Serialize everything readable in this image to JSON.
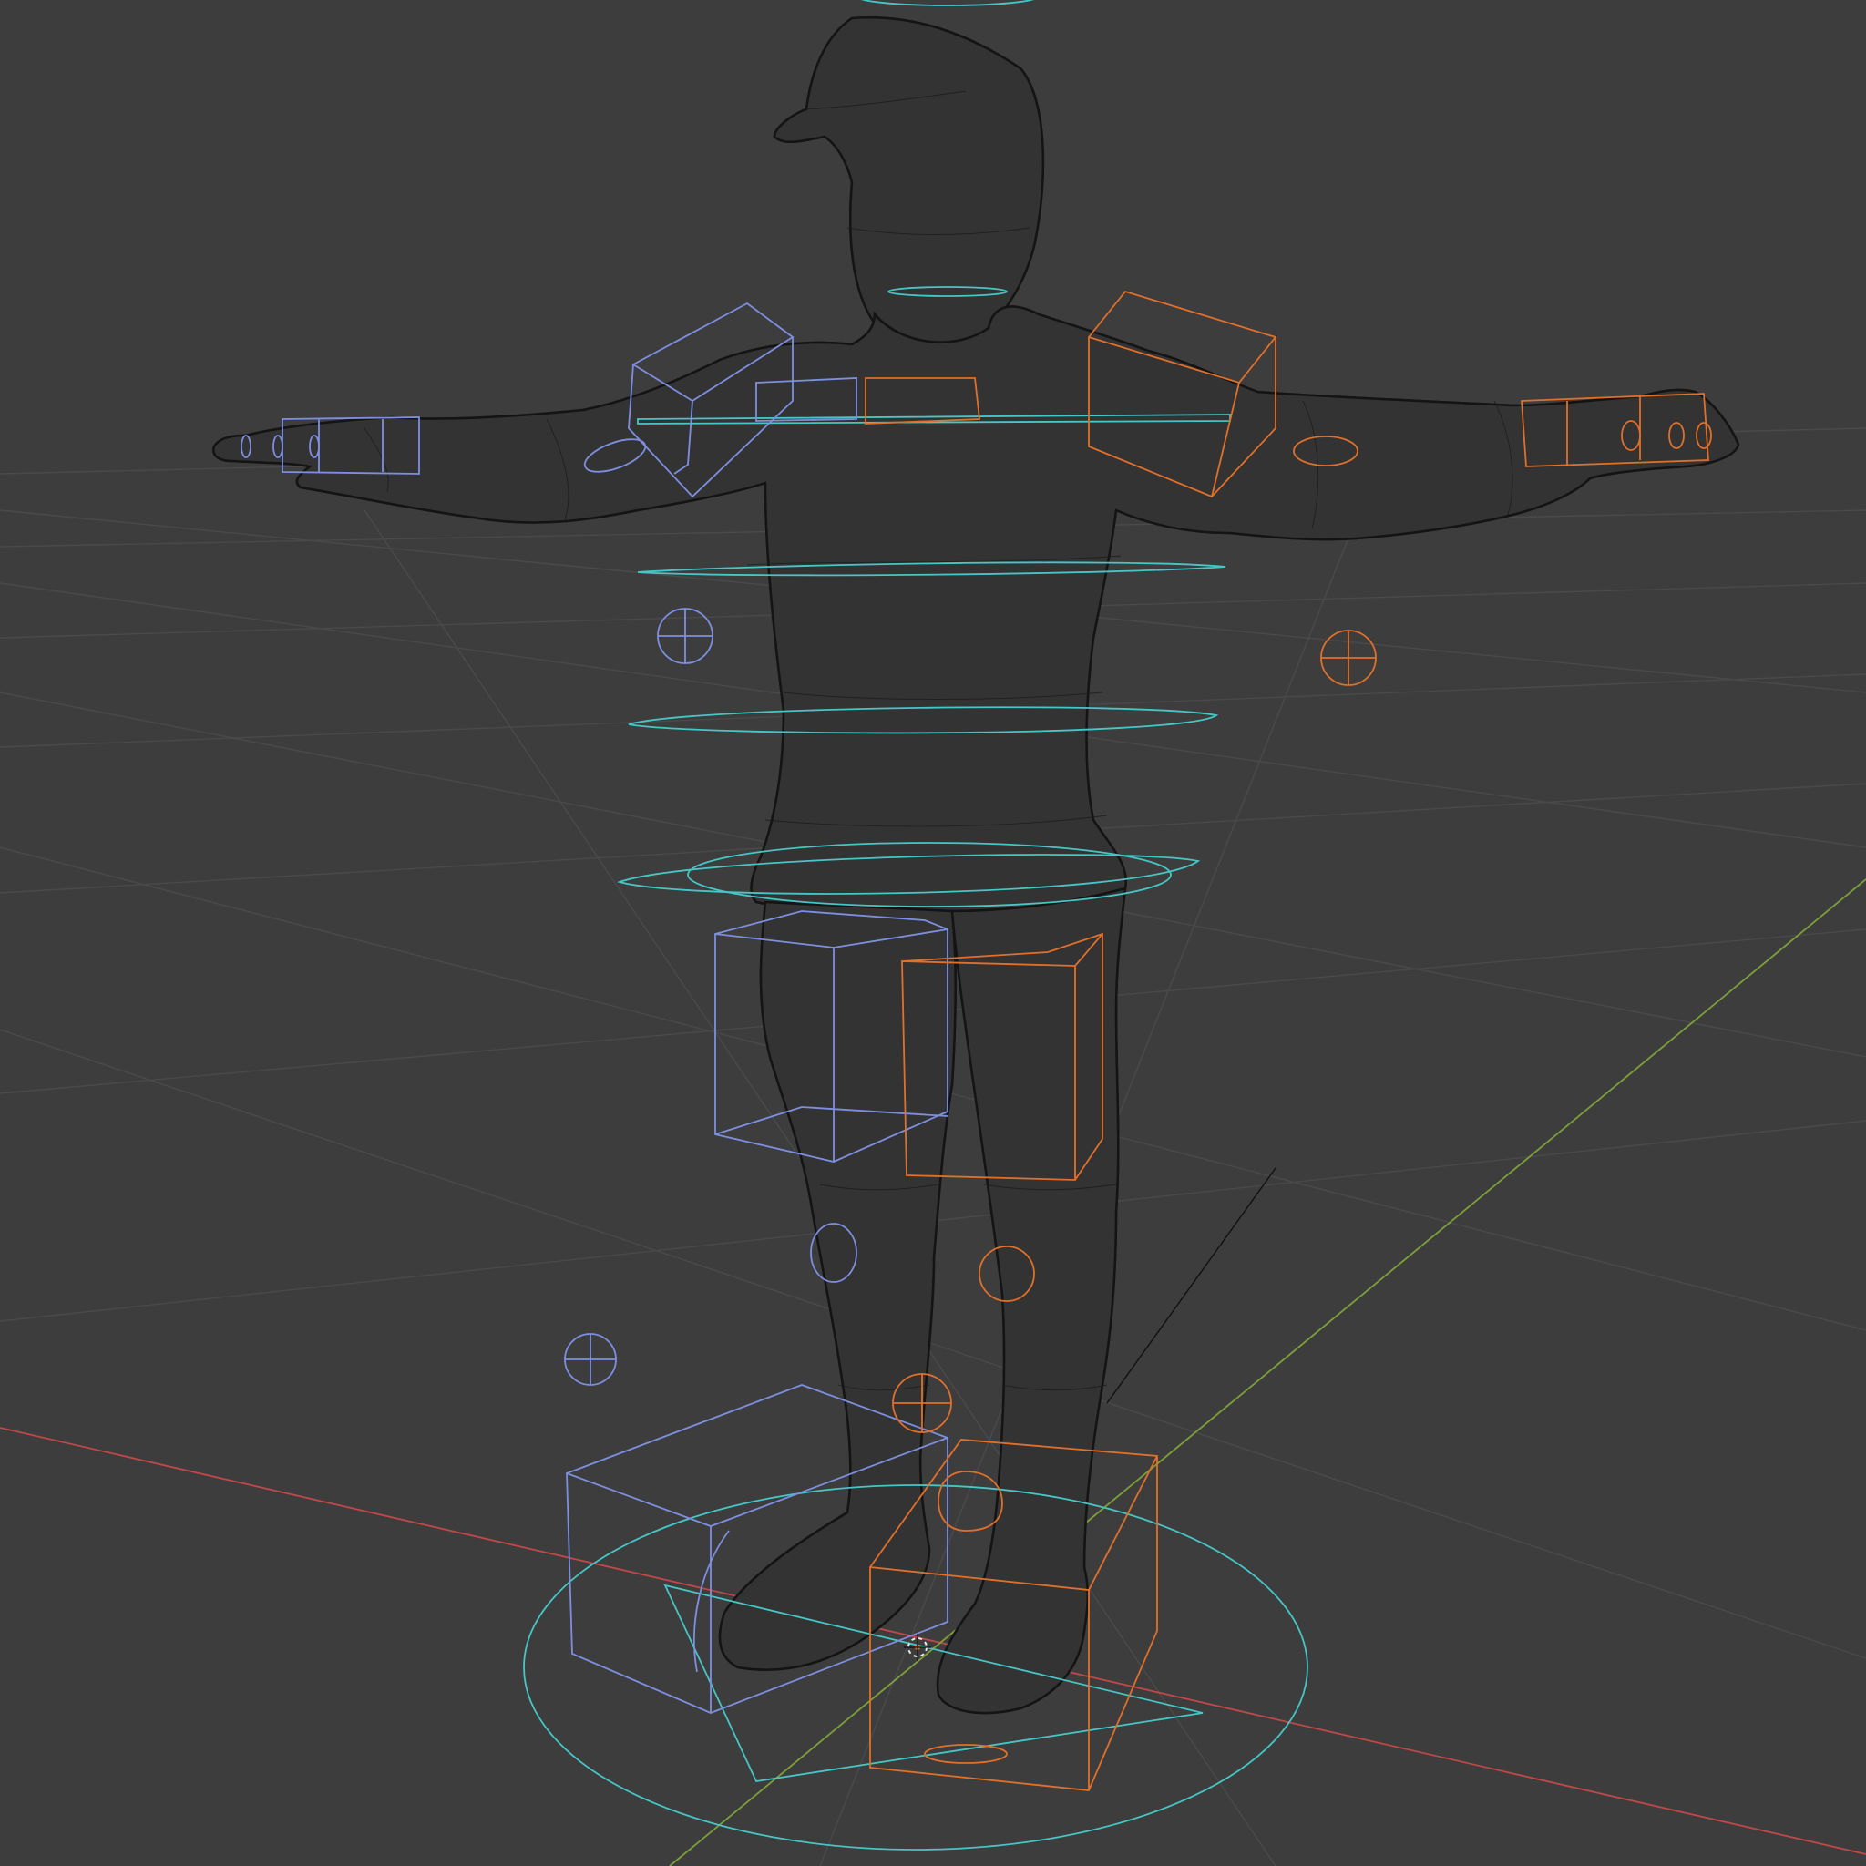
{
  "viewport": {
    "name": "3D Viewport",
    "shading_mode": "wireframe",
    "background_color": "#3d3d3d",
    "grid_color": "#4a4a4a",
    "axis_x_color": "#c04848",
    "axis_y_color": "#7da03a",
    "mesh_wire_color": "#141414",
    "center_controls_color": "#46c6c6",
    "left_side_controls_color": "#7d8fe0",
    "right_side_controls_color": "#e0702a",
    "objects": [
      "character-mesh",
      "character-rig"
    ],
    "cursor_icon": "3d-cursor-icon"
  }
}
